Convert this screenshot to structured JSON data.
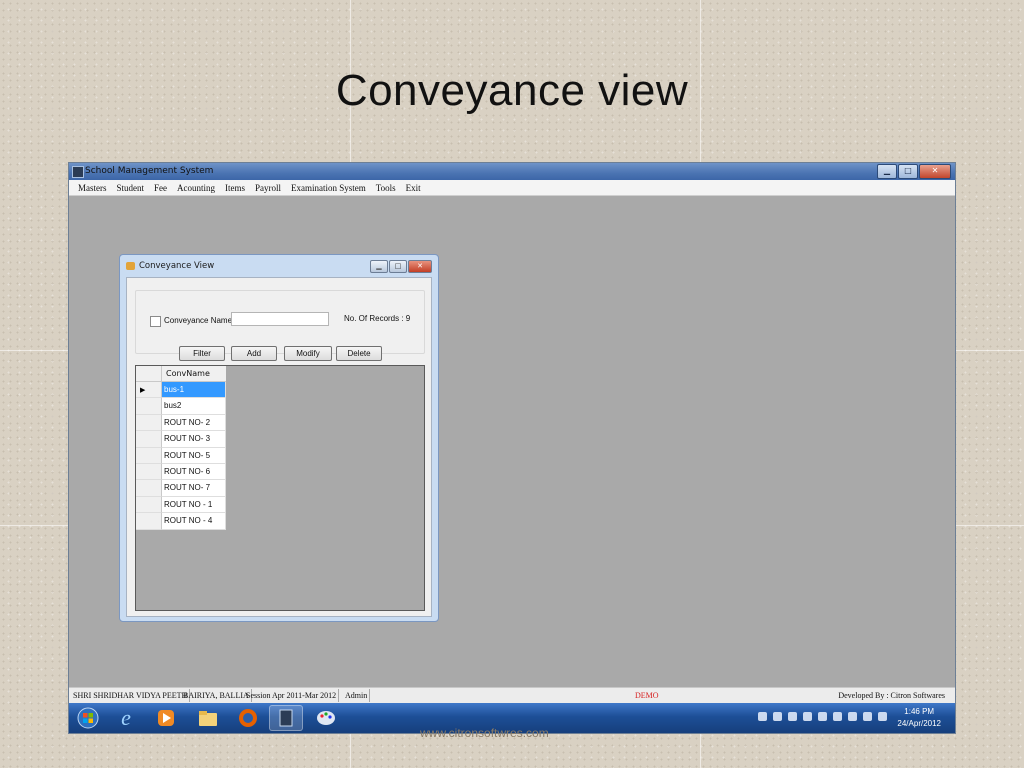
{
  "slide": {
    "title": "Conveyance view",
    "watermark": "www.citronsoftwres.com"
  },
  "app": {
    "title": "School Management System",
    "window_controls": [
      "minimize-icon",
      "maximize-icon",
      "close-icon"
    ],
    "menu": [
      "Masters",
      "Student",
      "Fee",
      "Acounting",
      "Items",
      "Payroll",
      "Examination System",
      "Tools",
      "Exit"
    ]
  },
  "conveyance_form": {
    "title": "Conveyance View",
    "filter": {
      "checkbox_label": "Conveyance Name",
      "checkbox_checked": false,
      "name_value": "",
      "record_count_text": "No. Of Records : 9"
    },
    "buttons": {
      "filter": "Filter",
      "add": "Add",
      "modify": "Modify",
      "delete": "Delete"
    },
    "grid": {
      "column": "ConvName",
      "rows": [
        "bus-1",
        "bus2",
        "ROUT NO- 2",
        "ROUT NO- 3",
        "ROUT NO- 5",
        "ROUT NO- 6",
        "ROUT NO- 7",
        "ROUT NO - 1",
        "ROUT NO - 4"
      ],
      "selected_index": 0
    }
  },
  "statusbar": {
    "school": "SHRI SHRIDHAR VIDYA PEETH",
    "location": "BAIRIYA, BALLIA",
    "session": "Session Apr 2011-Mar 2012",
    "user": "Admin",
    "mode": "DEMO",
    "developer": "Developed By : Citron Softwares"
  },
  "taskbar": {
    "apps": [
      "start-orb-icon",
      "internet-explorer-icon",
      "media-player-icon",
      "file-explorer-icon",
      "firefox-icon",
      "school-app-icon",
      "paint-icon"
    ],
    "time": "1:46 PM",
    "date": "24/Apr/2012"
  },
  "colors": {
    "selection": "#3399ff",
    "demo": "#d62020",
    "taskbar": "#1d4f97"
  }
}
